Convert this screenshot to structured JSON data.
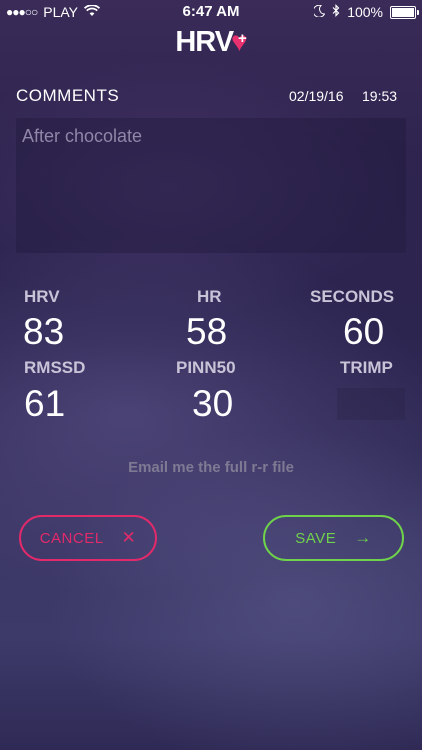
{
  "status_bar": {
    "signal_dots": "●●●○○",
    "carrier": "PLAY",
    "time": "6:47 AM",
    "battery_percent": "100%",
    "battery_level": 1.0
  },
  "logo": {
    "text": "HRV"
  },
  "comments": {
    "label": "COMMENTS",
    "date": "02/19/16",
    "time": "19:53",
    "value": "After chocolate"
  },
  "metrics": {
    "hrv": {
      "label": "HRV",
      "value": "83"
    },
    "hr": {
      "label": "HR",
      "value": "58"
    },
    "seconds": {
      "label": "SECONDS",
      "value": "60"
    },
    "rmssd": {
      "label": "RMSSD",
      "value": "61"
    },
    "pnn50": {
      "label": "PINN50",
      "value": "30"
    },
    "trimp": {
      "label": "TRIMP",
      "value": ""
    }
  },
  "email_link": "Email me the full r-r file",
  "buttons": {
    "cancel": "CANCEL",
    "save": "SAVE"
  },
  "colors": {
    "accent_pink": "#e22a6b",
    "accent_green": "#6fd24b"
  }
}
